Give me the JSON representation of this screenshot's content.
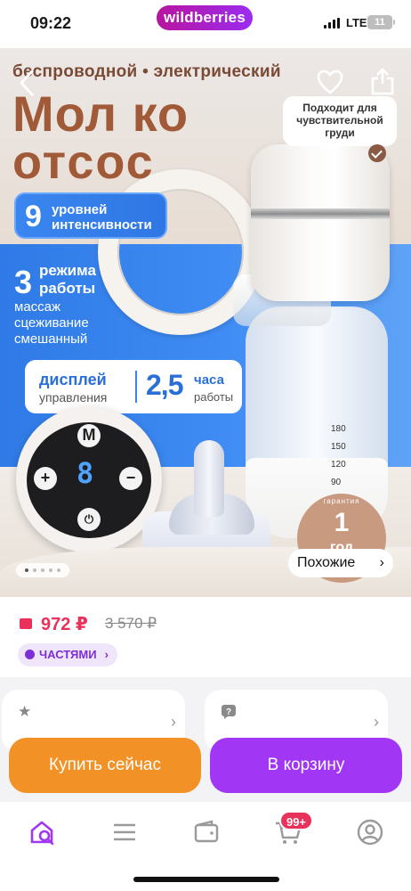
{
  "status_bar": {
    "time": "09:22",
    "brand": "wildberries",
    "network": "LTE",
    "battery": "11"
  },
  "hero": {
    "subtitle": "беспроводной • электрический",
    "title_line1": "Мол ко",
    "title_line2": "отсос",
    "sensitive_badge": "Подходит для чувствительной груди",
    "levels": {
      "number": "9",
      "text": "уровней интенсивности"
    },
    "modes": {
      "number": "3",
      "text": "режима работы",
      "list": [
        "массаж",
        "сцеживание",
        "смешанный"
      ]
    },
    "display": {
      "label1": "дисплей",
      "label2": "управления",
      "hours_number": "2,5",
      "hours_label1": "часа",
      "hours_label2": "работы"
    },
    "control_buttons": {
      "mode": "M",
      "plus": "+",
      "minus": "−"
    },
    "lcd_digit": "8",
    "bottle_scale": [
      "180",
      "150",
      "120",
      "90"
    ],
    "warranty": {
      "number": "1",
      "text": "год",
      "ring_text": "гарантия"
    },
    "similar_button": "Похожие",
    "gallery_dots": 5,
    "gallery_active_dot": 0
  },
  "price": {
    "current": "972 ₽",
    "old": "3 570 ₽"
  },
  "installments_label": "ЧАСТЯМИ",
  "actions": {
    "buy_now": "Купить сейчас",
    "add_to_cart": "В корзину"
  },
  "tabbar": {
    "cart_badge": "99+"
  },
  "colors": {
    "accent_purple": "#a136f5",
    "accent_orange": "#f29226",
    "price_red": "#e8315b"
  }
}
